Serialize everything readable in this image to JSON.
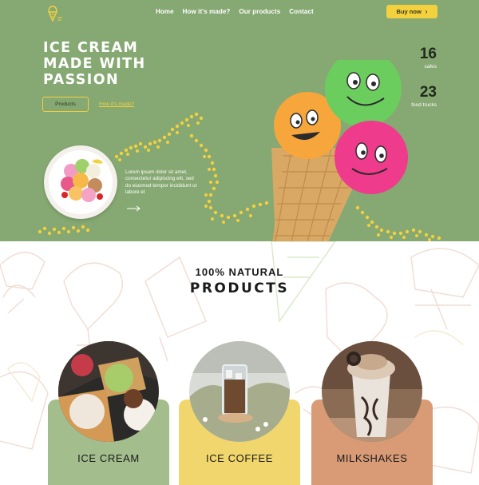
{
  "nav": {
    "links": [
      "Home",
      "How it's made?",
      "Our products",
      "Contact"
    ],
    "buy_label": "Buy now"
  },
  "hero": {
    "title_lines": [
      "ICE CREAM",
      "MADE WITH",
      "PASSION"
    ],
    "products_button": "Products",
    "how_link": "How it's made?",
    "description": "Lorem ipsum dolor sit amet, consectetur adipiscing elit, sed do eiusmod tempor incididunt ut labore et",
    "stats": [
      {
        "value": "16",
        "label": "cafes"
      },
      {
        "value": "23",
        "label": "food trucks"
      }
    ]
  },
  "products": {
    "subtitle": "100% NATURAL",
    "title": "PRODUCTS",
    "items": [
      {
        "label": "ICE CREAM",
        "color": "#a3bd8d"
      },
      {
        "label": "ICE COFFEE",
        "color": "#f0d66c"
      },
      {
        "label": "MILKSHAKES",
        "color": "#d89b76"
      }
    ]
  },
  "colors": {
    "hero_bg": "#86a872",
    "accent": "#f3d03e"
  }
}
